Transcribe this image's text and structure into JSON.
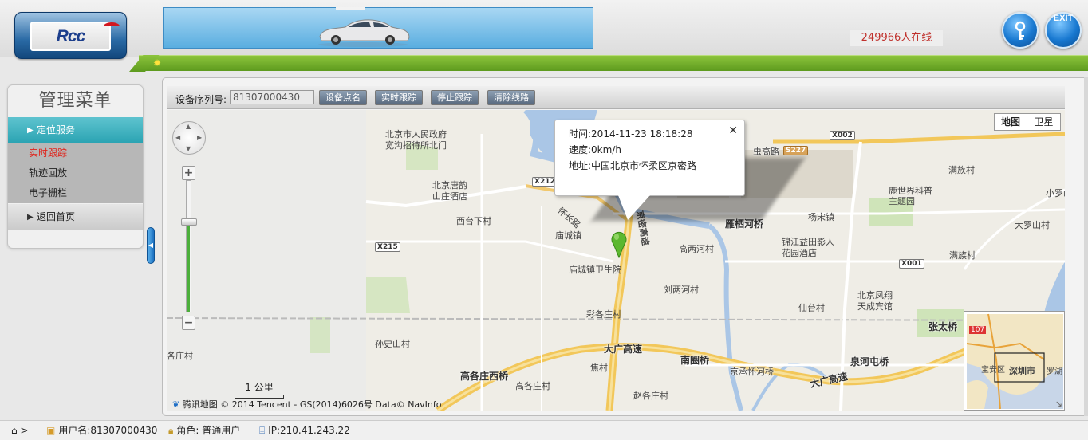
{
  "header": {
    "logo_text": "Rcc",
    "online_text": "249966人在线",
    "key_button_icon": "key-icon",
    "exit_button_label": "EXIT"
  },
  "sidebar": {
    "title": "管理菜单",
    "categories": [
      {
        "label": "定位服务",
        "items": [
          "实时跟踪",
          "轨迹回放",
          "电子栅栏"
        ]
      },
      {
        "label": "返回首页"
      }
    ]
  },
  "toolbar": {
    "serial_label": "设备序列号:",
    "serial_value": "81307000430",
    "buttons": [
      "设备点名",
      "实时跟踪",
      "停止跟踪",
      "清除线路"
    ]
  },
  "map": {
    "map_type": [
      "地图",
      "卫星"
    ],
    "popup": {
      "time": "时间:2014-11-23 18:18:28",
      "speed": "速度:0km/h",
      "address": "地址:中国北京市怀柔区京密路"
    },
    "scale": "1 公里",
    "credit": "腾讯地图 © 2014 Tencent - GS(2014)6026号 Data© NavInfo",
    "labels": {
      "l1": "北京市人民政府",
      "l2": "宽沟招待所北门",
      "l3": "北京唐韵",
      "l4": "山庄酒店",
      "l5": "西台下村",
      "l6": "庙城镇",
      "l7": "庙城镇卫生院",
      "l8": "怀长路",
      "l9": "京密高速",
      "l10": "虫高路",
      "l11": "雁栖河桥",
      "l12": "杨宋镇",
      "l13": "锦江益田影人",
      "l14": "花园酒店",
      "l15": "高两河村",
      "l16": "刘两河村",
      "l17": "彩各庄村",
      "l18": "孙史山村",
      "l19": "大广高速",
      "l20": "高各庄西桥",
      "l21": "高各庄村",
      "l22": "焦村",
      "l23": "南圈桥",
      "l24": "京承怀河桥",
      "l25": "泉河屯桥",
      "l26": "大广高速",
      "l27": "赵各庄村",
      "l28": "仙台村",
      "l29": "北京凤翔",
      "l30": "天成宾馆",
      "l31": "满族村",
      "l32": "鹿世界科普",
      "l33": "主题园",
      "l34": "大罗山村",
      "l35": "小罗山",
      "l36": "满族村",
      "l37": "张太桥",
      "l38": "各庄村"
    },
    "shields": [
      "X212",
      "X215",
      "S227",
      "X002",
      "X001"
    ],
    "minimap_labels": [
      "宝安区",
      "深圳市",
      "罗湖",
      "107"
    ]
  },
  "status": {
    "user": "用户名:81307000430",
    "role": "角色: 普通用户",
    "ip": "IP:210.41.243.22"
  }
}
